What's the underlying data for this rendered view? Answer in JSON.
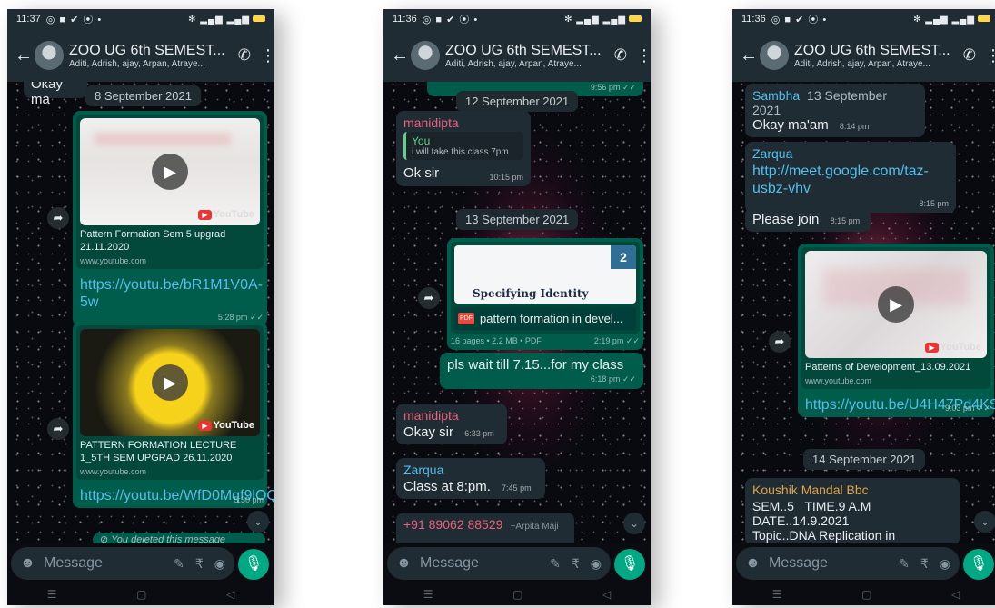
{
  "colors": {
    "header": "#1f2c33",
    "incoming": "#202c33",
    "outgoing": "#005c4b",
    "link": "#53bdeb",
    "mic": "#00a884",
    "sender_pink": "#e9627c",
    "sender_blue": "#53bdeb",
    "sender_orange": "#e0a34a",
    "sender_green": "#5fd18b"
  },
  "common": {
    "group_title": "ZOO UG 6th SEMEST...",
    "group_members": "Aditi, Adrish, ajay, Arpan, Atraye...",
    "input_placeholder": "Message",
    "icons": {
      "back": "arrow-left-icon",
      "call": "phone-add-icon",
      "menu": "more-vertical-icon",
      "emoji": "emoji-icon",
      "attach": "paperclip-icon",
      "payment": "rupee-icon",
      "camera": "camera-icon",
      "mic": "microphone-icon",
      "forward": "forward-icon",
      "scroll": "chevron-double-down-icon"
    }
  },
  "screens": [
    {
      "status_time": "11:37",
      "status_right": "✻ ᵛᵒˡᵗᴱ .ıl ᵛᵒˡ ıl",
      "partial_top": "Okay ma",
      "date_chip": "8 September 2021",
      "video1": {
        "title": "Pattern Formation Sem 5 upgrad 21.11.2020",
        "domain": "www.youtube.com",
        "link": "https://youtu.be/bR1M1V0A-5w",
        "time": "5:28 pm ✓✓",
        "brand": "YouTube"
      },
      "video2": {
        "title": "PATTERN FORMATION LECTURE 1_5TH SEM UPGRAD 26.11.2020",
        "domain": "www.youtube.com",
        "link": "https://youtu.be/WfD0Mqf9lOQ",
        "time": "5:30 pm",
        "brand": "YouTube"
      },
      "deleted": "You deleted this message"
    },
    {
      "status_time": "11:36",
      "status_right": "✻ ᵛᵒˡᵗᴱ .ıl ᵛᵒˡ ıl",
      "partial_time": "9:56 pm ✓✓",
      "date_chip1": "12 September 2021",
      "reply_msg": {
        "sender": "manidipta",
        "quoted_sender": "You",
        "quoted_text": "i will take this class 7pm",
        "text": "Ok sir",
        "time": "10:15 pm"
      },
      "date_chip2": "13 September 2021",
      "pdf": {
        "page_num": "2",
        "heading": "Specifying Identity",
        "badge": "PDF",
        "name": "pattern formation in devel...",
        "info": "16 pages • 2.2 MB • PDF",
        "time": "2:19 pm ✓✓"
      },
      "out_msg": {
        "text": "pls wait till 7.15...for my class",
        "time": "6:18 pm ✓✓"
      },
      "msg2": {
        "sender": "manidipta",
        "text": "Okay sir",
        "time": "6:33 pm"
      },
      "msg3": {
        "sender": "Zarqua",
        "text": "Class at 8:pm.",
        "time": "7:45 pm"
      },
      "msg4": {
        "sender": "+91 89062 88529",
        "alias": "~Arpita Maji"
      }
    },
    {
      "status_time": "11:36",
      "status_right": "✻ ᵛᵒˡᵗᴱ .ıl ᵛᵒˡ ıl",
      "msg1": {
        "sender": "Sambha",
        "date": "13 September 2021",
        "text": "Okay ma'am",
        "time": "8:14 pm"
      },
      "msg2": {
        "sender": "Zarqua",
        "link": "http://meet.google.com/taz-usbz-vhv",
        "time": "8:15 pm"
      },
      "msg3": {
        "text": "Please join",
        "time": "8:15 pm"
      },
      "video": {
        "title": "Patterns of Development_13.09.2021",
        "domain": "www.youtube.com",
        "link": "https://youtu.be/U4H47Pd4KS0",
        "time": "9:03 pm ✓✓",
        "brand": "YouTube"
      },
      "date_chip": "14 September 2021",
      "msg4": {
        "sender": "Koushik Mandal Bbc",
        "line1": "SEM..5   TIME.9 A.M",
        "line2": "DATE..14.9.2021",
        "line3": "Topic..DNA Replication in"
      }
    }
  ]
}
